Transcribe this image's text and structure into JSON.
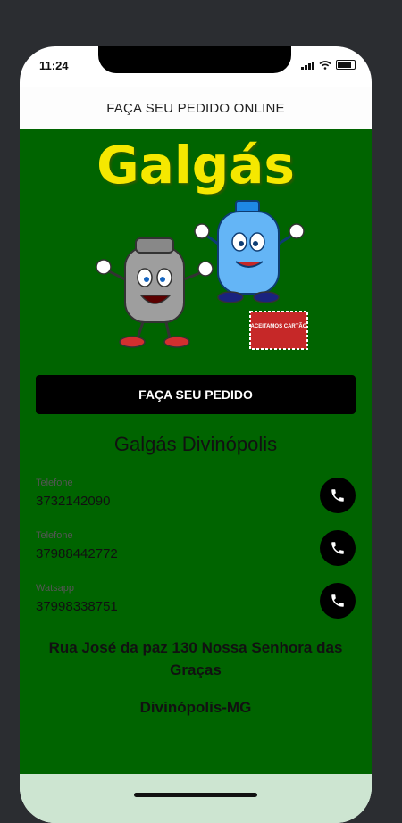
{
  "status": {
    "time": "11:24"
  },
  "appbar": {
    "title": "FAÇA SEU PEDIDO ONLINE"
  },
  "brand": {
    "logo_text": "Galgás",
    "badge_text": "ACEITAMOS CARTÃO"
  },
  "order_button": {
    "label": "FAÇA SEU PEDIDO"
  },
  "store": {
    "name": "Galgás Divinópolis"
  },
  "contacts": [
    {
      "label": "Telefone",
      "value": "3732142090",
      "icon": "phone-icon"
    },
    {
      "label": "Telefone",
      "value": "37988442772",
      "icon": "phone-icon"
    },
    {
      "label": "Watsapp",
      "value": "37998338751",
      "icon": "phone-icon"
    }
  ],
  "address": {
    "street": "Rua José da paz 130 Nossa Senhora das Graças",
    "city": "Divinópolis-MG"
  },
  "colors": {
    "background": "#006400",
    "logo": "#f5e800",
    "button": "#000000"
  }
}
